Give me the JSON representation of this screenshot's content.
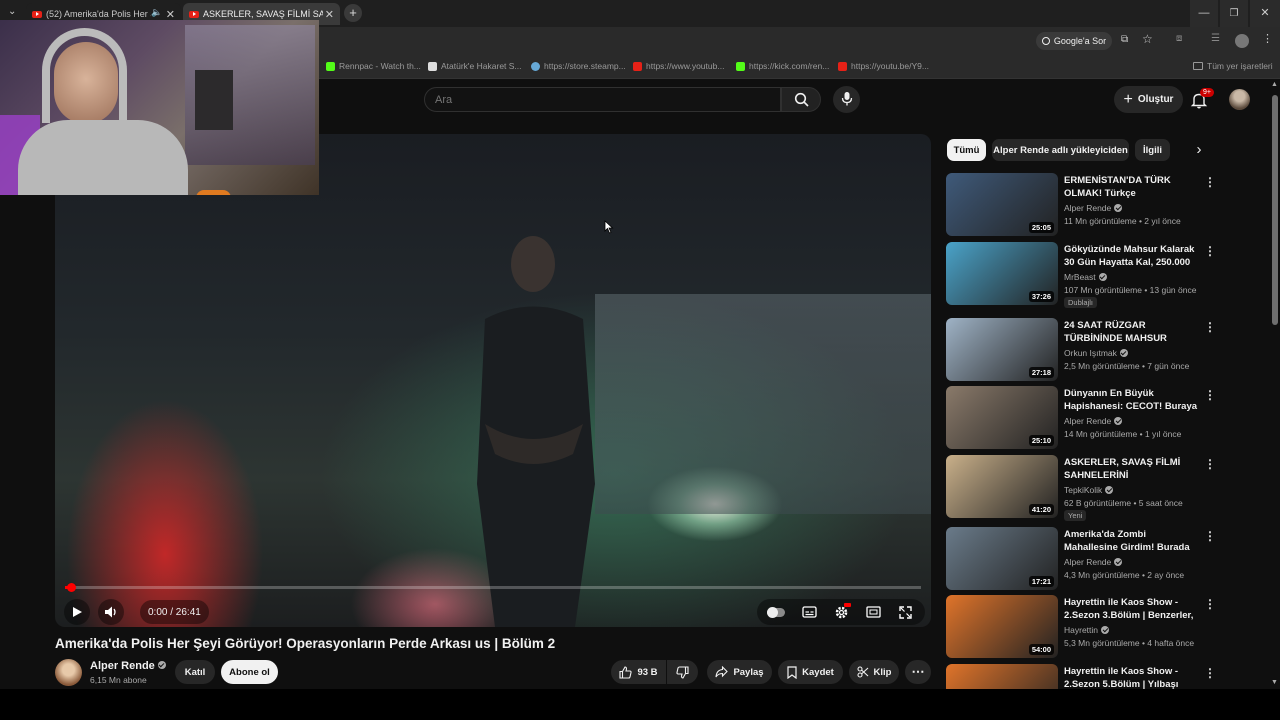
{
  "browser": {
    "tabs": [
      {
        "label": "(52) Amerika'da Polis Her Ş"
      },
      {
        "label": "ASKERLER, SAVAŞ FİLMİ SAHNE"
      }
    ],
    "new_tab": "+",
    "google_ask": "Google'a Sor",
    "bookmarks": [
      {
        "label": "Rennpac - Watch th...",
        "icon_color": "#53fc18"
      },
      {
        "label": "Atatürk'e Hakaret S...",
        "icon_color": "#dddddd"
      },
      {
        "label": "https://store.steamp...",
        "icon_color": "#66a8d6"
      },
      {
        "label": "https://www.youtub...",
        "icon_color": "#e62117"
      },
      {
        "label": "https://kick.com/ren...",
        "icon_color": "#53fc18"
      },
      {
        "label": "https://youtu.be/Y9...",
        "icon_color": "#e62117"
      }
    ],
    "all_bookmarks": "Tüm yer işaretleri"
  },
  "masthead": {
    "search_placeholder": "Ara",
    "create_label": "Oluştur",
    "notifications_badge": "9+"
  },
  "player": {
    "time": "0:00 / 26:41",
    "progress": 0.0
  },
  "video": {
    "title": "Amerika'da Polis Her Şeyi Görüyor! Operasyonların Perde Arkası us | Bölüm 2",
    "channel": "Alper Rende",
    "subscribers": "6,15 Mn abone",
    "join_label": "Katıl",
    "subscribe_label": "Abone ol",
    "likes": "93 B",
    "share_label": "Paylaş",
    "save_label": "Kaydet",
    "clip_label": "Klip"
  },
  "chips": [
    {
      "label": "Tümü"
    },
    {
      "label": "Alper Rende adlı yükleyiciden"
    },
    {
      "label": "İlgili"
    }
  ],
  "recommendations": [
    {
      "title": "ERMENİSTAN'DA TÜRK OLMAK! Türkçe konuştuğumuzu duyan ...",
      "channel": "Alper Rende",
      "meta": "11 Mn görüntüleme • 2 yıl önce",
      "duration": "25:05",
      "badge": "",
      "thumb_color": "#3f5a7a"
    },
    {
      "title": "Gökyüzünde Mahsur Kalarak 30 Gün Hayatta Kal, 250.000 Dola...",
      "channel": "MrBeast",
      "meta": "107 Mn görüntüleme • 13 gün önce",
      "duration": "37:26",
      "badge": "Dublajlı",
      "thumb_color": "#4aa3c9"
    },
    {
      "title": "24 SAAT RÜZGAR TÜRBİNİNDE MAHSUR KALMAK!",
      "channel": "Orkun Işıtmak",
      "meta": "2,5 Mn görüntüleme • 7 gün önce",
      "duration": "27:18",
      "badge": "",
      "thumb_color": "#9fb3c6"
    },
    {
      "title": "Dünyanın En Büyük Hapishanesi: CECOT! Buraya ...",
      "channel": "Alper Rende",
      "meta": "14 Mn görüntüleme • 1 yıl önce",
      "duration": "25:10",
      "badge": "",
      "thumb_color": "#8a7a6a"
    },
    {
      "title": "ASKERLER, SAVAŞ FİLMİ SAHNELERİNİ YORUMLUYOR!",
      "channel": "TepkiKolik",
      "meta": "62 B görüntüleme • 5 saat önce",
      "duration": "41:20",
      "badge": "Yeni",
      "thumb_color": "#c9b08a"
    },
    {
      "title": "Amerika'da Zombi Mahallesine Girdim! Burada Her Şey Yasal! ...",
      "channel": "Alper Rende",
      "meta": "4,3 Mn görüntüleme • 2 ay önce",
      "duration": "17:21",
      "badge": "",
      "thumb_color": "#6a7b8a"
    },
    {
      "title": "Hayrettin ile Kaos Show - 2.Sezon 3.Bölüm | Benzerler, ...",
      "channel": "Hayrettin",
      "meta": "5,3 Mn görüntüleme • 4 hafta önce",
      "duration": "54:00",
      "badge": "",
      "thumb_color": "#e0742a"
    },
    {
      "title": "Hayrettin ile Kaos Show - 2.Sezon 5.Bölüm | Yılbaşı Özel...",
      "channel": "",
      "meta": "",
      "duration": "",
      "badge": "",
      "thumb_color": "#e0742a"
    }
  ]
}
